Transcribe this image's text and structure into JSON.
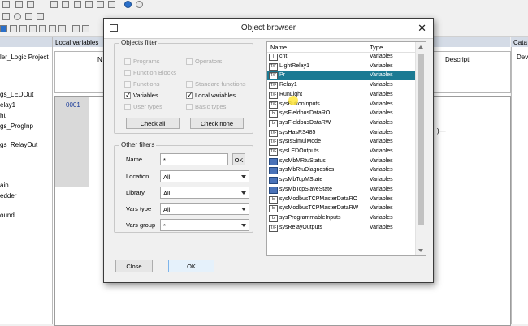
{
  "app": {
    "left_panel": {
      "tree": [
        "ler_Logic Project",
        "gs_LEDOut",
        "elay1",
        "ht",
        "gs_ProgInp",
        "gs_RelayOut",
        "ain",
        "edder",
        "ound"
      ]
    },
    "center_panel": {
      "title": "Local variables",
      "col_n": "N",
      "col_descr": "Descripti",
      "rung_number": "0001"
    },
    "right_panel": {
      "title": "Cata",
      "row": "Dev"
    }
  },
  "dialog": {
    "title": "Object browser",
    "objects_filter": {
      "legend": "Objects filter",
      "items": [
        {
          "label": "Programs",
          "checked": false,
          "enabled": false
        },
        {
          "label": "Operators",
          "checked": false,
          "enabled": false
        },
        {
          "label": "Function Blocks",
          "checked": false,
          "enabled": false
        },
        {
          "label": "Functions",
          "checked": false,
          "enabled": false
        },
        {
          "label": "Standard functions",
          "checked": false,
          "enabled": false
        },
        {
          "label": "Variables",
          "checked": true,
          "enabled": true
        },
        {
          "label": "Local variables",
          "checked": true,
          "enabled": true
        },
        {
          "label": "User types",
          "checked": false,
          "enabled": false
        },
        {
          "label": "Basic types",
          "checked": false,
          "enabled": false
        }
      ],
      "check_all": "Check all",
      "check_none": "Check none"
    },
    "other_filters": {
      "legend": "Other filters",
      "name_label": "Name",
      "name_value": "*",
      "ok_label": "OK",
      "location_label": "Location",
      "location_value": "All",
      "library_label": "Library",
      "library_value": "All",
      "vars_type_label": "Vars type",
      "vars_type_value": "All",
      "vars_group_label": "Vars group",
      "vars_group_value": "*"
    },
    "list": {
      "col_name": "Name",
      "col_type": "Type",
      "rows": [
        {
          "icon": "I",
          "name": "cnt",
          "type": "Variables"
        },
        {
          "icon": "T/F",
          "name": "LightRelay1",
          "type": "Variables"
        },
        {
          "icon": "T/F",
          "name": "Pr",
          "type": "Variables",
          "selected": true
        },
        {
          "icon": "T/F",
          "name": "Relay1",
          "type": "Variables"
        },
        {
          "icon": "T/F",
          "name": "RunLight",
          "type": "Variables"
        },
        {
          "icon": "T/F",
          "name": "sysButtonInputs",
          "type": "Variables"
        },
        {
          "icon": "b",
          "name": "sysFieldbusDataRO",
          "type": "Variables"
        },
        {
          "icon": "b",
          "name": "sysFieldbusDataRW",
          "type": "Variables"
        },
        {
          "icon": "T/F",
          "name": "sysHasRS485",
          "type": "Variables"
        },
        {
          "icon": "T/F",
          "name": "sysIsSimulMode",
          "type": "Variables"
        },
        {
          "icon": "T/F",
          "name": "sysLEDOutputs",
          "type": "Variables"
        },
        {
          "icon": "blue",
          "name": "sysMbMRtuStatus",
          "type": "Variables"
        },
        {
          "icon": "blue",
          "name": "sysMbRtuDiagnostics",
          "type": "Variables"
        },
        {
          "icon": "blue",
          "name": "sysMbTcpMState",
          "type": "Variables"
        },
        {
          "icon": "blue",
          "name": "sysMbTcpSlaveState",
          "type": "Variables"
        },
        {
          "icon": "b",
          "name": "sysModbusTCPMasterDataRO",
          "type": "Variables"
        },
        {
          "icon": "b",
          "name": "sysModbusTCPMasterDataRW",
          "type": "Variables"
        },
        {
          "icon": "b",
          "name": "sysProgrammableInputs",
          "type": "Variables"
        },
        {
          "icon": "T/F",
          "name": "sysRelayOutputs",
          "type": "Variables"
        }
      ]
    },
    "close_label": "Close",
    "ok_label": "OK"
  }
}
